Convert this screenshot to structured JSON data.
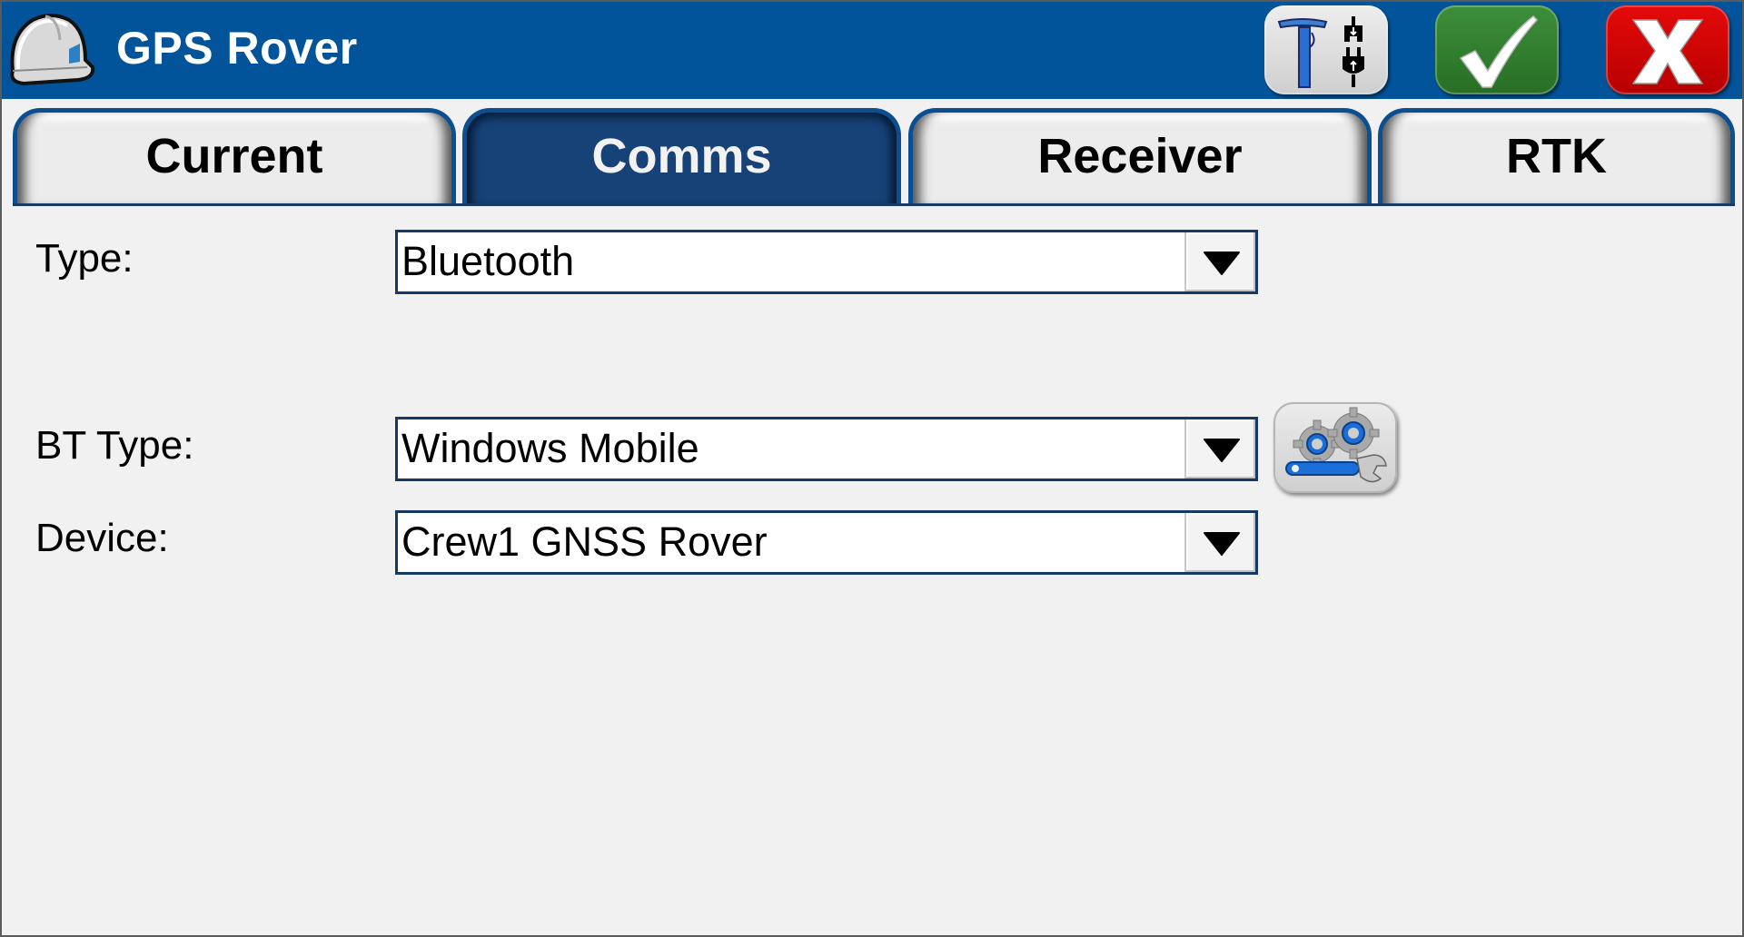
{
  "header": {
    "title": "GPS Rover",
    "app_icon": "hard-hat-icon",
    "buttons": [
      {
        "name": "gps-connect-button",
        "icon": "gps-pole-plug-icon"
      },
      {
        "name": "accept-button",
        "icon": "checkmark-icon"
      },
      {
        "name": "cancel-button",
        "icon": "close-x-icon"
      }
    ]
  },
  "tabs": [
    {
      "label": "Current",
      "active": false
    },
    {
      "label": "Comms",
      "active": true
    },
    {
      "label": "Receiver",
      "active": false
    },
    {
      "label": "RTK",
      "active": false
    }
  ],
  "form": {
    "type": {
      "label": "Type:",
      "value": "Bluetooth"
    },
    "bt_type": {
      "label": "BT Type:",
      "value": "Windows Mobile"
    },
    "device": {
      "label": "Device:",
      "value": "Crew1 GNSS Rover"
    },
    "settings_button_icon": "gears-wrench-icon"
  },
  "colors": {
    "header_bg": "#02549a",
    "active_tab_bg": "#174277",
    "tab_border": "#0b4f91",
    "ok_green": "#2f7d2c",
    "cancel_red": "#d40000",
    "content_bg": "#f1f1f1"
  }
}
